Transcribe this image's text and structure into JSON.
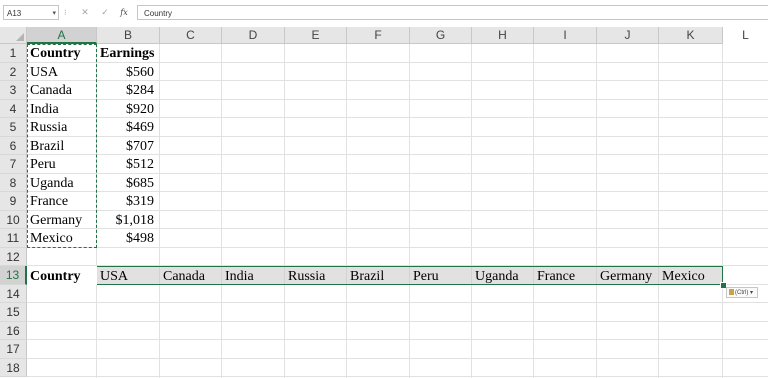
{
  "formula_bar": {
    "name_box": "A13",
    "separator": "⁝",
    "cancel_icon": "✕",
    "enter_icon": "✓",
    "fx_label": "fx",
    "content": "Country"
  },
  "columns": [
    "A",
    "B",
    "C",
    "D",
    "E",
    "F",
    "G",
    "H",
    "I",
    "J",
    "K",
    "L"
  ],
  "rows": [
    "1",
    "2",
    "3",
    "4",
    "5",
    "6",
    "7",
    "8",
    "9",
    "10",
    "11",
    "12",
    "13",
    "14",
    "15",
    "16",
    "17",
    "18"
  ],
  "table": {
    "header": [
      "Country",
      "Earnings"
    ],
    "rows": [
      [
        "USA",
        "$560"
      ],
      [
        "Canada",
        "$284"
      ],
      [
        "India",
        "$920"
      ],
      [
        "Russia",
        "$469"
      ],
      [
        "Brazil",
        "$707"
      ],
      [
        "Peru",
        "$512"
      ],
      [
        "Uganda",
        "$685"
      ],
      [
        "France",
        "$319"
      ],
      [
        "Germany",
        "$1,018"
      ],
      [
        "Mexico",
        "$498"
      ]
    ]
  },
  "transposed_row": [
    "Country",
    "USA",
    "Canada",
    "India",
    "Russia",
    "Brazil",
    "Peru",
    "Uganda",
    "France",
    "Germany",
    "Mexico"
  ],
  "paste_options": {
    "label": "(Ctrl)",
    "chevron": "▾"
  },
  "colors": {
    "accent": "#217346",
    "header_bg": "#e6e6e6",
    "grid": "#e1e1e1"
  }
}
